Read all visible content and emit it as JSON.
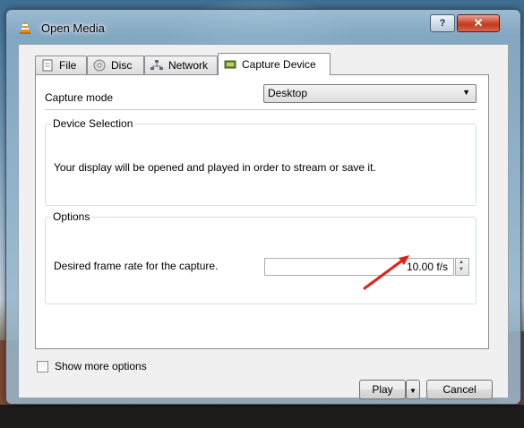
{
  "window": {
    "title": "Open Media",
    "help_label": "?",
    "close_label": "✕"
  },
  "tabs": [
    {
      "label": "File",
      "icon": "file-icon"
    },
    {
      "label": "Disc",
      "icon": "disc-icon"
    },
    {
      "label": "Network",
      "icon": "network-icon"
    },
    {
      "label": "Capture Device",
      "icon": "capture-device-icon",
      "active": true
    }
  ],
  "capture": {
    "mode_label": "Capture mode",
    "mode_value": "Desktop"
  },
  "device_selection": {
    "title": "Device Selection",
    "text": "Your display will be opened and played in order to stream or save it."
  },
  "options": {
    "title": "Options",
    "frame_rate_label": "Desired frame rate for the capture.",
    "frame_rate_value": "10.00 f/s"
  },
  "footer": {
    "show_more_label": "Show more options",
    "show_more_checked": false,
    "play_label": "Play",
    "cancel_label": "Cancel"
  },
  "colors": {
    "annotation_arrow": "#e0201c",
    "vlc_cone": "#f08a00"
  }
}
